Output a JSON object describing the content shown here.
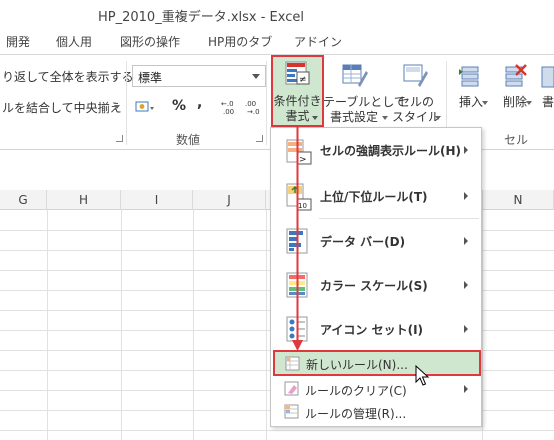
{
  "window": {
    "title": "HP_2010_重複データ.xlsx - Excel"
  },
  "tabs": [
    "開発",
    "個人用",
    "図形の操作",
    "HP用のタブ",
    "アドイン"
  ],
  "ribbon": {
    "alignment": {
      "wrap_text": "り返して全体を表示する",
      "merge_center": "ルを結合して中央揃え"
    },
    "number": {
      "format_value": "標準",
      "percent": "%",
      "comma": ",",
      "group_label": "数値"
    },
    "styles": {
      "conditional_formatting": [
        "条件付き",
        "書式"
      ],
      "format_as_table": [
        "テーブルとして",
        "書式設定"
      ],
      "cell_styles": [
        "セルの",
        "スタイル"
      ]
    },
    "cells": {
      "insert": "挿入",
      "delete": "削除",
      "format_partial": "書",
      "group_label": "セル"
    }
  },
  "columns": [
    "G",
    "H",
    "I",
    "J",
    "N"
  ],
  "menu": {
    "items": [
      {
        "label": "セルの強調表示ルール(H)",
        "icon": "highlight-rules-icon",
        "submenu": true
      },
      {
        "label": "上位/下位ルール(T)",
        "icon": "top-bottom-rules-icon",
        "submenu": true
      },
      {
        "label": "データ バー(D)",
        "icon": "data-bars-icon",
        "submenu": true
      },
      {
        "label": "カラー スケール(S)",
        "icon": "color-scales-icon",
        "submenu": true
      },
      {
        "label": "アイコン セット(I)",
        "icon": "icon-sets-icon",
        "submenu": true
      }
    ],
    "secondary": [
      {
        "label": "新しいルール(N)...",
        "icon": "new-rule-icon",
        "highlighted": true
      },
      {
        "label": "ルールのクリア(C)",
        "icon": "clear-rules-icon",
        "submenu": true
      },
      {
        "label": "ルールの管理(R)...",
        "icon": "manage-rules-icon"
      }
    ]
  },
  "colors": {
    "highlight_green": "#cfe7cf",
    "annotation_red": "#e0383c"
  }
}
